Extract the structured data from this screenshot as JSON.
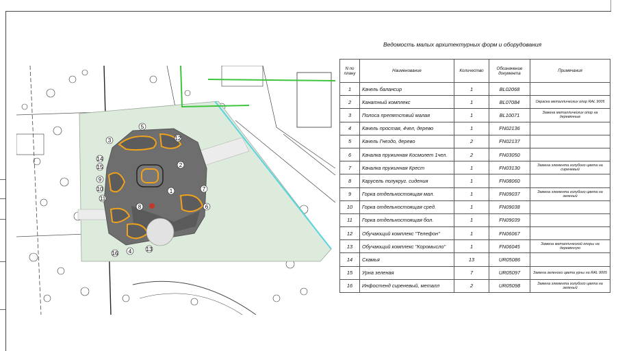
{
  "title": "Ведомость малых архитектурных форм и оборудования",
  "table": {
    "headers": {
      "n": "N по плану",
      "name": "Наименование",
      "qty": "Количество",
      "code": "Обозначение документа",
      "note": "Примечания"
    },
    "rows": [
      {
        "n": "1",
        "name": "Качель балансир",
        "qty": "1",
        "code": "BL02068",
        "note": ""
      },
      {
        "n": "2",
        "name": "Канатный комплекс",
        "qty": "1",
        "code": "BL07084",
        "note": "Окраска металлических опор RAL 9005"
      },
      {
        "n": "3",
        "name": "Полоса препятствий малая",
        "qty": "1",
        "code": "BL10071",
        "note": "Замена металлических опор на деревянные"
      },
      {
        "n": "4",
        "name": "Качель простая, 4чел, дерево",
        "qty": "1",
        "code": "FN02136",
        "note": ""
      },
      {
        "n": "5",
        "name": "Качель Гнездо, дерево",
        "qty": "2",
        "code": "FN02137",
        "note": ""
      },
      {
        "n": "6",
        "name": "Качалка пружинная Космолет 1чел.",
        "qty": "2",
        "code": "FN03050",
        "note": ""
      },
      {
        "n": "7",
        "name": "Качалка пружинная Крест",
        "qty": "1",
        "code": "FN03130",
        "note": "Замена элемента голубого цвета на сиреневый"
      },
      {
        "n": "8",
        "name": "Карусель полукруг. сидения",
        "qty": "1",
        "code": "FN08060",
        "note": ""
      },
      {
        "n": "9",
        "name": "Горка отдельностоящая мал.",
        "qty": "1",
        "code": "FN09037",
        "note": "Замена элемента голубого цвета на зеленый"
      },
      {
        "n": "10",
        "name": "Горка отдельностоящая сред.",
        "qty": "1",
        "code": "FN09038",
        "note": ""
      },
      {
        "n": "11",
        "name": "Горка отдельностоящая бол.",
        "qty": "1",
        "code": "FN09039",
        "note": ""
      },
      {
        "n": "12",
        "name": "Обучающий комплекс \"Телефон\"",
        "qty": "1",
        "code": "FN06067",
        "note": ""
      },
      {
        "n": "13",
        "name": "Обучающий комплекс \"Коромысло\"",
        "qty": "1",
        "code": "FN06045",
        "note": "Замена металлической опоры на деревянную"
      },
      {
        "n": "14",
        "name": "Скамья",
        "qty": "13",
        "code": "UR05086",
        "note": ""
      },
      {
        "n": "15",
        "name": "Урна зеленая",
        "qty": "7",
        "code": "UR05097",
        "note": "Замена зеленого цвета урны на RAL 9005"
      },
      {
        "n": "16",
        "name": "Инфостенд сиреневый, металл",
        "qty": "2",
        "code": "UR05098",
        "note": "Замена элемента голубого цвета на зеленый"
      }
    ]
  },
  "plan": {
    "markers": [
      "1",
      "2",
      "3",
      "4",
      "5",
      "6",
      "7",
      "8",
      "9",
      "10",
      "11",
      "12",
      "13",
      "14",
      "15",
      "16"
    ]
  },
  "colors": {
    "zone_fill": "#dcebdc",
    "playground": "#6e6e6e",
    "accent_orange": "#f0a21c",
    "green_line": "#3cc43c",
    "cyan_line": "#58d4dc"
  }
}
